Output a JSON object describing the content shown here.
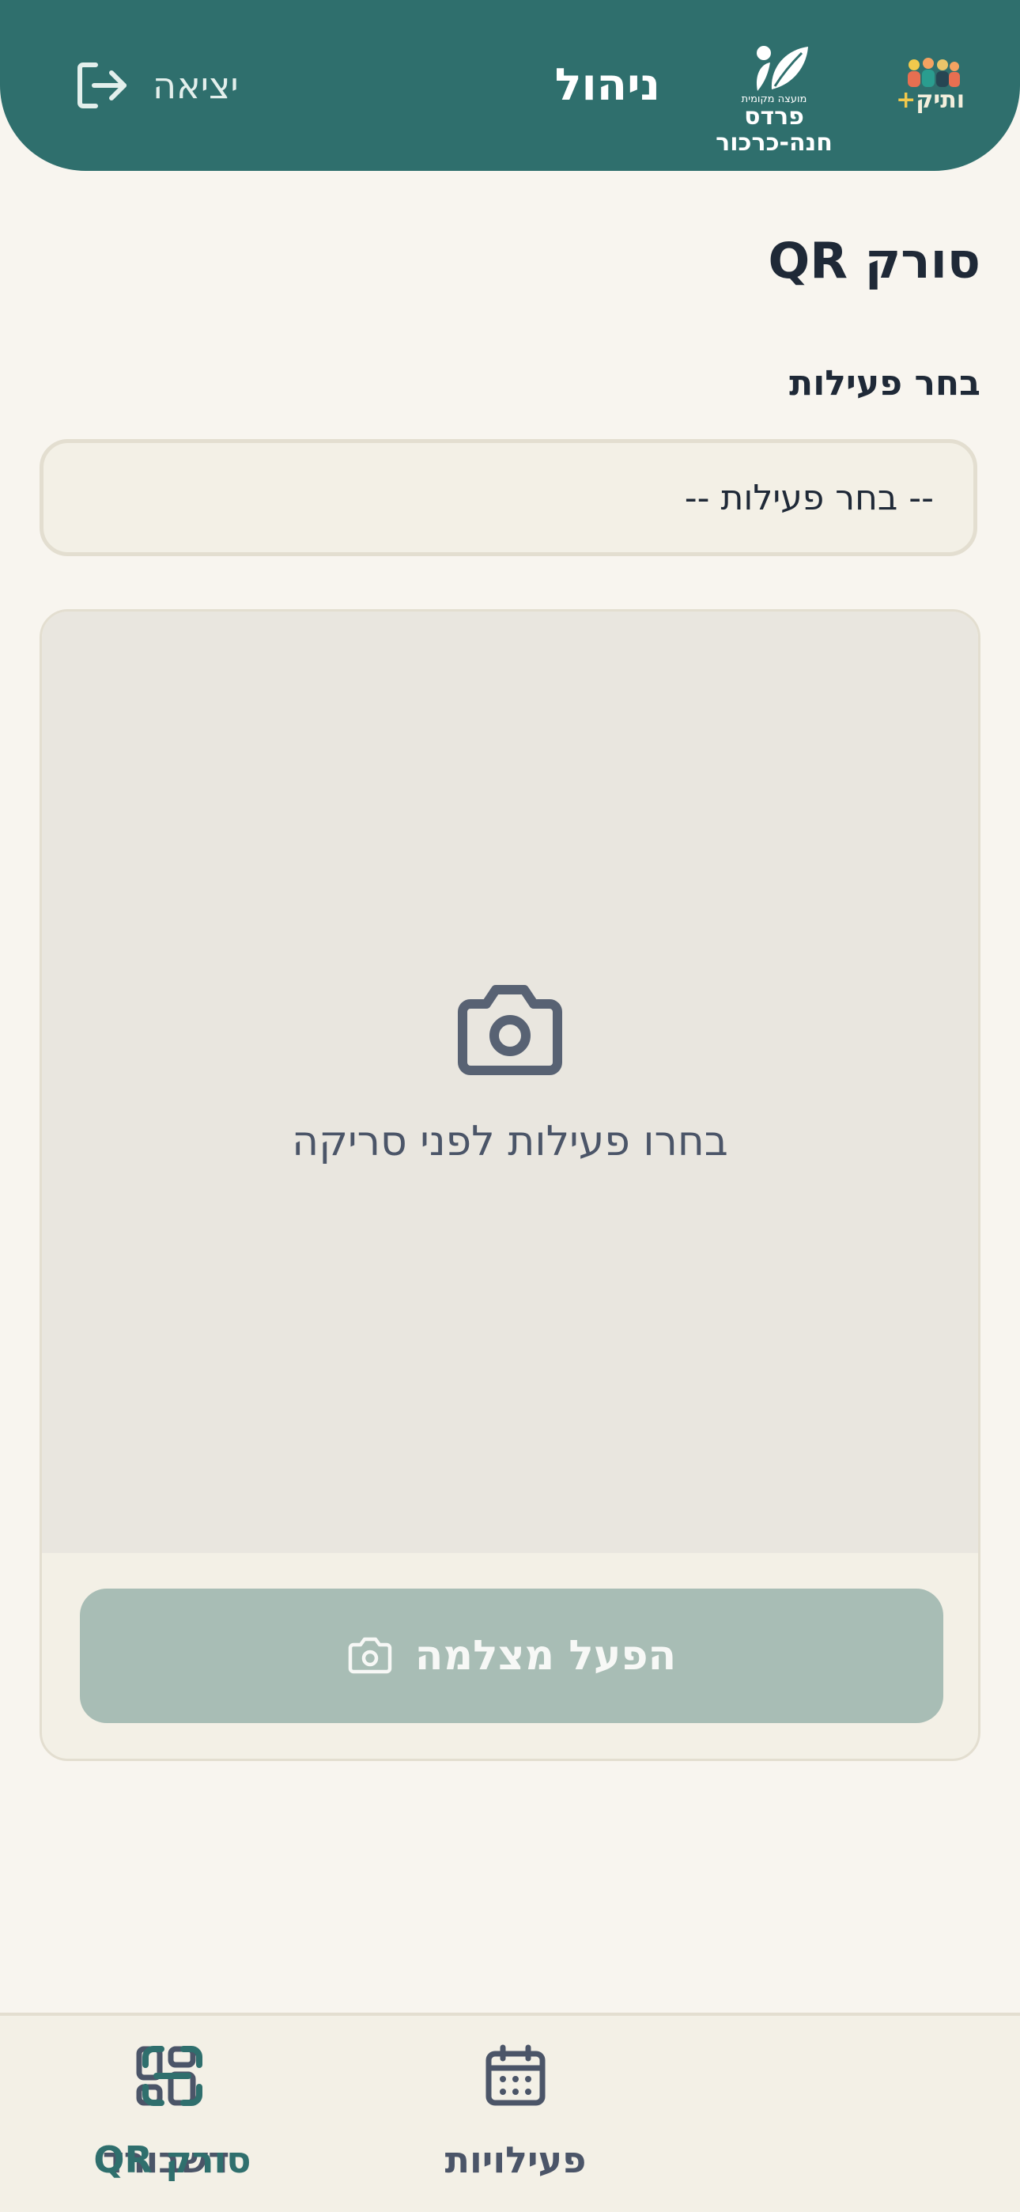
{
  "header": {
    "title": "ניהול",
    "logout_label": "יציאה",
    "brand_vatik": {
      "text": "ותיק",
      "plus": "+"
    },
    "brand_city": {
      "small_text": "מועצה מקומית",
      "big_text": "פרדס חנה-כרכור"
    }
  },
  "main": {
    "page_title": "סורק QR",
    "select_label": "בחר פעילות",
    "select_value": "-- בחר פעילות --",
    "scanner_hint": "בחרו פעילות לפני סריקה",
    "camera_button_label": "הפעל מצלמה"
  },
  "bottom_nav": {
    "items": [
      {
        "label": "דשבורד",
        "icon": "dashboard-icon",
        "active": false
      },
      {
        "label": "פעילויות",
        "icon": "calendar-icon",
        "active": false
      },
      {
        "label": "סורק QR",
        "icon": "qr-scan-icon",
        "active": true
      }
    ]
  },
  "colors": {
    "header_bg": "#2f6f6d",
    "page_bg": "#f8f5ef",
    "active_nav": "#2f6f6d",
    "disabled_button": "#a8bdb5",
    "accent_plus": "#f2c94c"
  }
}
